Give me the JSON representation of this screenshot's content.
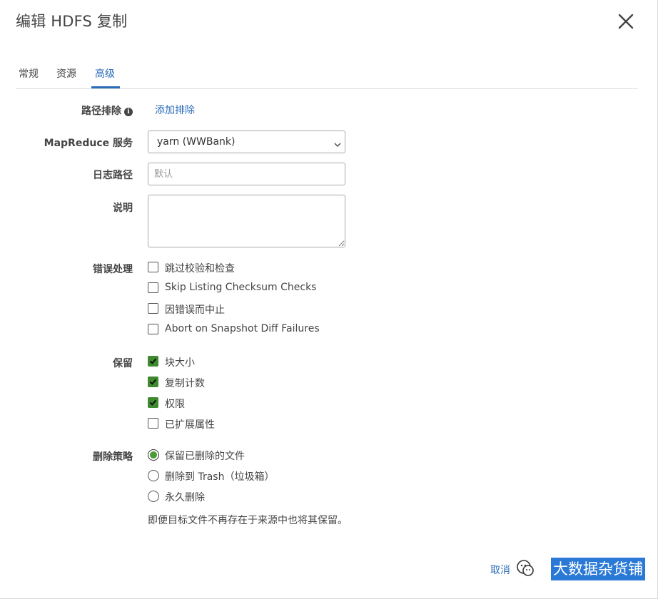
{
  "dialog": {
    "title": "编辑 HDFS 复制",
    "close_icon": "close-icon"
  },
  "tabs": [
    {
      "label": "常规",
      "active": false
    },
    {
      "label": "资源",
      "active": false
    },
    {
      "label": "高级",
      "active": true
    }
  ],
  "form": {
    "path_exclusion": {
      "label": "路径排除",
      "info_icon": "info-icon",
      "link": "添加排除"
    },
    "mapreduce": {
      "label": "MapReduce 服务",
      "selected": "yarn (WWBank)"
    },
    "log_path": {
      "label": "日志路径",
      "value": "",
      "placeholder": "默认"
    },
    "description": {
      "label": "说明",
      "value": ""
    },
    "error_handling": {
      "label": "错误处理",
      "options": [
        {
          "label": "跳过校验和检查",
          "checked": false
        },
        {
          "label": "Skip Listing Checksum Checks",
          "checked": false
        },
        {
          "label": "因错误而中止",
          "checked": false
        },
        {
          "label": "Abort on Snapshot Diff Failures",
          "checked": false
        }
      ]
    },
    "preserve": {
      "label": "保留",
      "options": [
        {
          "label": "块大小",
          "checked": true
        },
        {
          "label": "复制计数",
          "checked": true
        },
        {
          "label": "权限",
          "checked": true
        },
        {
          "label": "已扩展属性",
          "checked": false
        }
      ]
    },
    "delete_policy": {
      "label": "删除策略",
      "options": [
        {
          "label": "保留已删除的文件",
          "selected": true
        },
        {
          "label": "删除到 Trash（垃圾箱）",
          "selected": false
        },
        {
          "label": "永久删除",
          "selected": false
        }
      ],
      "help": "即便目标文件不再存在于来源中也将其保留。"
    }
  },
  "footer": {
    "cancel_partial": "取消"
  },
  "watermark": {
    "text": "大数据杂货铺",
    "logo_icon": "wechat-logo-icon"
  },
  "colors": {
    "link": "#2b6cb8",
    "check": "#3f8a2e",
    "watermark_bg": "#2a79d6"
  }
}
